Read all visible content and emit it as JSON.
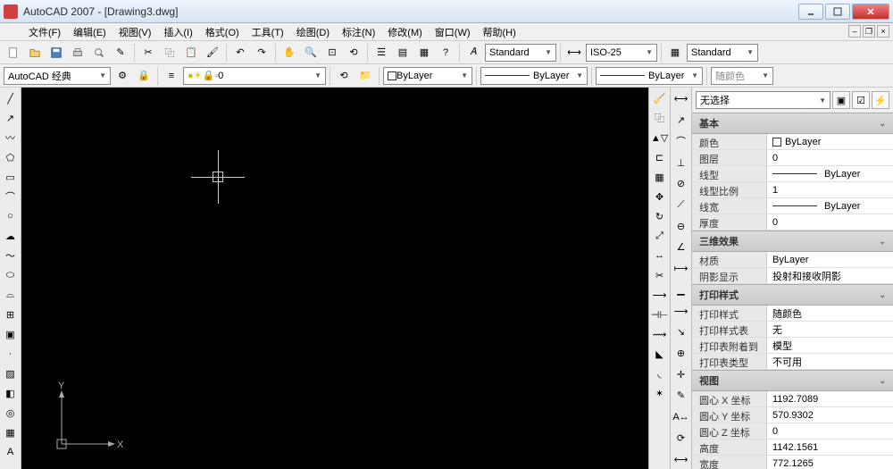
{
  "app": {
    "title": "AutoCAD 2007 - [Drawing3.dwg]"
  },
  "menu": [
    "文件(F)",
    "编辑(E)",
    "视图(V)",
    "插入(I)",
    "格式(O)",
    "工具(T)",
    "绘图(D)",
    "标注(N)",
    "修改(M)",
    "窗口(W)",
    "帮助(H)"
  ],
  "toolbar1": {
    "style_combo": "Standard",
    "dim_combo": "ISO-25",
    "text_combo": "Standard"
  },
  "toolbar2": {
    "workspace": "AutoCAD 经典",
    "layer": "0",
    "bylayer1": "ByLayer",
    "bylayer2": "ByLayer",
    "bylayer3": "ByLayer",
    "color_combo": "随颜色"
  },
  "panel": {
    "selection": "无选择",
    "sections": {
      "basic": {
        "title": "基本",
        "rows": [
          {
            "label": "颜色",
            "value": "ByLayer",
            "swatch": true
          },
          {
            "label": "图层",
            "value": "0"
          },
          {
            "label": "线型",
            "value": "ByLayer",
            "line": true
          },
          {
            "label": "线型比例",
            "value": "1"
          },
          {
            "label": "线宽",
            "value": "ByLayer",
            "line": true
          },
          {
            "label": "厚度",
            "value": "0"
          }
        ]
      },
      "threed": {
        "title": "三维效果",
        "rows": [
          {
            "label": "材质",
            "value": "ByLayer"
          },
          {
            "label": "阴影显示",
            "value": "投射和接收阴影"
          }
        ]
      },
      "print": {
        "title": "打印样式",
        "rows": [
          {
            "label": "打印样式",
            "value": "随颜色"
          },
          {
            "label": "打印样式表",
            "value": "无"
          },
          {
            "label": "打印表附着到",
            "value": "模型"
          },
          {
            "label": "打印表类型",
            "value": "不可用"
          }
        ]
      },
      "view": {
        "title": "视图",
        "rows": [
          {
            "label": "圆心 X 坐标",
            "value": "1192.7089"
          },
          {
            "label": "圆心 Y 坐标",
            "value": "570.9302"
          },
          {
            "label": "圆心 Z 坐标",
            "value": "0"
          },
          {
            "label": "高度",
            "value": "1142.1561"
          },
          {
            "label": "宽度",
            "value": "772.1265"
          }
        ]
      }
    }
  }
}
